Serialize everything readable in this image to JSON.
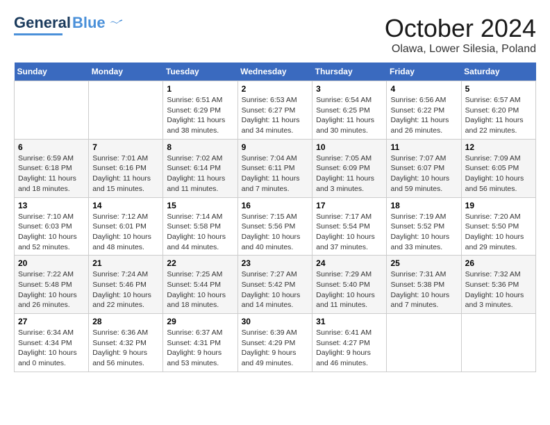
{
  "header": {
    "logo_general": "General",
    "logo_blue": "Blue",
    "month": "October 2024",
    "location": "Olawa, Lower Silesia, Poland"
  },
  "weekdays": [
    "Sunday",
    "Monday",
    "Tuesday",
    "Wednesday",
    "Thursday",
    "Friday",
    "Saturday"
  ],
  "weeks": [
    [
      {
        "day": "",
        "info": ""
      },
      {
        "day": "",
        "info": ""
      },
      {
        "day": "1",
        "info": "Sunrise: 6:51 AM\nSunset: 6:29 PM\nDaylight: 11 hours and 38 minutes."
      },
      {
        "day": "2",
        "info": "Sunrise: 6:53 AM\nSunset: 6:27 PM\nDaylight: 11 hours and 34 minutes."
      },
      {
        "day": "3",
        "info": "Sunrise: 6:54 AM\nSunset: 6:25 PM\nDaylight: 11 hours and 30 minutes."
      },
      {
        "day": "4",
        "info": "Sunrise: 6:56 AM\nSunset: 6:22 PM\nDaylight: 11 hours and 26 minutes."
      },
      {
        "day": "5",
        "info": "Sunrise: 6:57 AM\nSunset: 6:20 PM\nDaylight: 11 hours and 22 minutes."
      }
    ],
    [
      {
        "day": "6",
        "info": "Sunrise: 6:59 AM\nSunset: 6:18 PM\nDaylight: 11 hours and 18 minutes."
      },
      {
        "day": "7",
        "info": "Sunrise: 7:01 AM\nSunset: 6:16 PM\nDaylight: 11 hours and 15 minutes."
      },
      {
        "day": "8",
        "info": "Sunrise: 7:02 AM\nSunset: 6:14 PM\nDaylight: 11 hours and 11 minutes."
      },
      {
        "day": "9",
        "info": "Sunrise: 7:04 AM\nSunset: 6:11 PM\nDaylight: 11 hours and 7 minutes."
      },
      {
        "day": "10",
        "info": "Sunrise: 7:05 AM\nSunset: 6:09 PM\nDaylight: 11 hours and 3 minutes."
      },
      {
        "day": "11",
        "info": "Sunrise: 7:07 AM\nSunset: 6:07 PM\nDaylight: 10 hours and 59 minutes."
      },
      {
        "day": "12",
        "info": "Sunrise: 7:09 AM\nSunset: 6:05 PM\nDaylight: 10 hours and 56 minutes."
      }
    ],
    [
      {
        "day": "13",
        "info": "Sunrise: 7:10 AM\nSunset: 6:03 PM\nDaylight: 10 hours and 52 minutes."
      },
      {
        "day": "14",
        "info": "Sunrise: 7:12 AM\nSunset: 6:01 PM\nDaylight: 10 hours and 48 minutes."
      },
      {
        "day": "15",
        "info": "Sunrise: 7:14 AM\nSunset: 5:58 PM\nDaylight: 10 hours and 44 minutes."
      },
      {
        "day": "16",
        "info": "Sunrise: 7:15 AM\nSunset: 5:56 PM\nDaylight: 10 hours and 40 minutes."
      },
      {
        "day": "17",
        "info": "Sunrise: 7:17 AM\nSunset: 5:54 PM\nDaylight: 10 hours and 37 minutes."
      },
      {
        "day": "18",
        "info": "Sunrise: 7:19 AM\nSunset: 5:52 PM\nDaylight: 10 hours and 33 minutes."
      },
      {
        "day": "19",
        "info": "Sunrise: 7:20 AM\nSunset: 5:50 PM\nDaylight: 10 hours and 29 minutes."
      }
    ],
    [
      {
        "day": "20",
        "info": "Sunrise: 7:22 AM\nSunset: 5:48 PM\nDaylight: 10 hours and 26 minutes."
      },
      {
        "day": "21",
        "info": "Sunrise: 7:24 AM\nSunset: 5:46 PM\nDaylight: 10 hours and 22 minutes."
      },
      {
        "day": "22",
        "info": "Sunrise: 7:25 AM\nSunset: 5:44 PM\nDaylight: 10 hours and 18 minutes."
      },
      {
        "day": "23",
        "info": "Sunrise: 7:27 AM\nSunset: 5:42 PM\nDaylight: 10 hours and 14 minutes."
      },
      {
        "day": "24",
        "info": "Sunrise: 7:29 AM\nSunset: 5:40 PM\nDaylight: 10 hours and 11 minutes."
      },
      {
        "day": "25",
        "info": "Sunrise: 7:31 AM\nSunset: 5:38 PM\nDaylight: 10 hours and 7 minutes."
      },
      {
        "day": "26",
        "info": "Sunrise: 7:32 AM\nSunset: 5:36 PM\nDaylight: 10 hours and 3 minutes."
      }
    ],
    [
      {
        "day": "27",
        "info": "Sunrise: 6:34 AM\nSunset: 4:34 PM\nDaylight: 10 hours and 0 minutes."
      },
      {
        "day": "28",
        "info": "Sunrise: 6:36 AM\nSunset: 4:32 PM\nDaylight: 9 hours and 56 minutes."
      },
      {
        "day": "29",
        "info": "Sunrise: 6:37 AM\nSunset: 4:31 PM\nDaylight: 9 hours and 53 minutes."
      },
      {
        "day": "30",
        "info": "Sunrise: 6:39 AM\nSunset: 4:29 PM\nDaylight: 9 hours and 49 minutes."
      },
      {
        "day": "31",
        "info": "Sunrise: 6:41 AM\nSunset: 4:27 PM\nDaylight: 9 hours and 46 minutes."
      },
      {
        "day": "",
        "info": ""
      },
      {
        "day": "",
        "info": ""
      }
    ]
  ]
}
